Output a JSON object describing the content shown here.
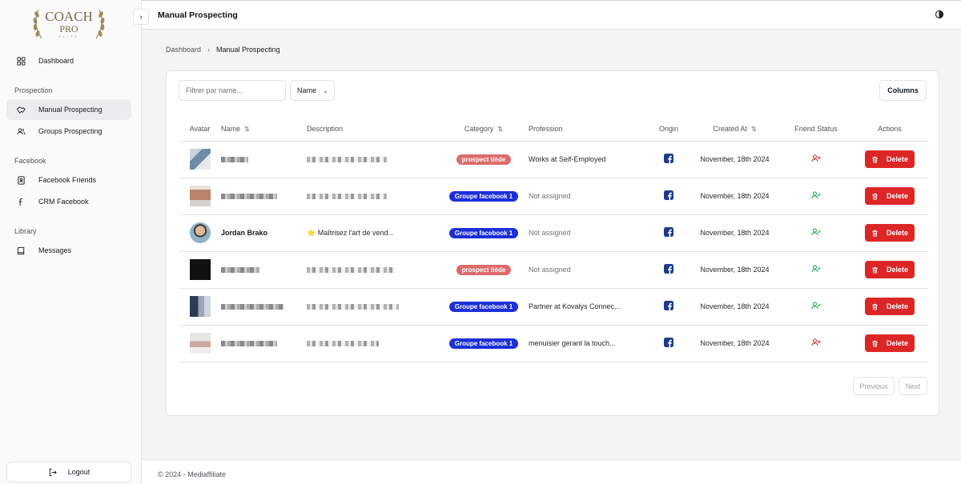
{
  "brand": {
    "line1": "COACH",
    "line2": "PRO",
    "line3": "ELITE"
  },
  "sidebar": {
    "dashboard": "Dashboard",
    "sections": [
      {
        "title": "Prospection",
        "items": [
          {
            "label": "Manual Prospecting",
            "icon": "handshake-icon",
            "active": true
          },
          {
            "label": "Groups Prospecting",
            "icon": "users-icon"
          }
        ]
      },
      {
        "title": "Facebook",
        "items": [
          {
            "label": "Facebook Friends",
            "icon": "contact-book-icon"
          },
          {
            "label": "CRM Facebook",
            "icon": "facebook-f-icon"
          }
        ]
      },
      {
        "title": "Library",
        "items": [
          {
            "label": "Messages",
            "icon": "book-icon"
          }
        ]
      }
    ],
    "logout": "Logout"
  },
  "header": {
    "title": "Manual Prospecting"
  },
  "breadcrumb": {
    "root": "Dashboard",
    "current": "Manual Prospecting"
  },
  "toolbar": {
    "filter_placeholder": "Filtrer par name...",
    "select_value": "Name",
    "columns_label": "Columns"
  },
  "table": {
    "columns": {
      "avatar": "Avatar",
      "name": "Name",
      "description": "Description",
      "category": "Category",
      "profession": "Profession",
      "origin": "Origin",
      "created_at": "Created At",
      "friend_status": "Friend Status",
      "actions": "Actions"
    },
    "rows": [
      {
        "name": "",
        "description": "",
        "category": "prospect tiède",
        "category_color": "#dc6b6b",
        "profession": "Works at Self-Employed",
        "created_at": "November, 18th 2024",
        "friend": "not-friend",
        "delete": "Delete"
      },
      {
        "name": "",
        "description": "",
        "category": "Groupe facebook 1",
        "category_color": "#1d2fd8",
        "profession": "Not assigned",
        "created_at": "November, 18th 2024",
        "friend": "friend",
        "delete": "Delete"
      },
      {
        "name": "Jordan Brako",
        "description": "⭐ Maîtrisez l'art de vend...",
        "category": "Groupe facebook 1",
        "category_color": "#1d2fd8",
        "profession": "Not assigned",
        "created_at": "November, 18th 2024",
        "friend": "friend",
        "delete": "Delete"
      },
      {
        "name": "",
        "description": "",
        "category": "prospect tiède",
        "category_color": "#dc6b6b",
        "profession": "Not assigned",
        "created_at": "November, 18th 2024",
        "friend": "friend",
        "delete": "Delete"
      },
      {
        "name": "",
        "description": "",
        "category": "Groupe facebook 1",
        "category_color": "#1d2fd8",
        "profession": "Partner at Kovalys Connec...",
        "created_at": "November, 18th 2024",
        "friend": "friend",
        "delete": "Delete"
      },
      {
        "name": "",
        "description": "",
        "category": "Groupe facebook 1",
        "category_color": "#1d2fd8",
        "profession": "menuisier gerant la touch...",
        "created_at": "November, 18th 2024",
        "friend": "not-friend",
        "delete": "Delete"
      }
    ]
  },
  "pagination": {
    "previous": "Previous",
    "next": "Next"
  },
  "footer": {
    "text": "©  2024 - Mediaffiliate"
  },
  "colors": {
    "danger": "#dc2626",
    "group_badge": "#1d2fd8",
    "prospect_badge": "#dc6b6b",
    "facebook": "#1e3a8a",
    "friend_ok": "#16a34a",
    "friend_no": "#dc2626"
  }
}
